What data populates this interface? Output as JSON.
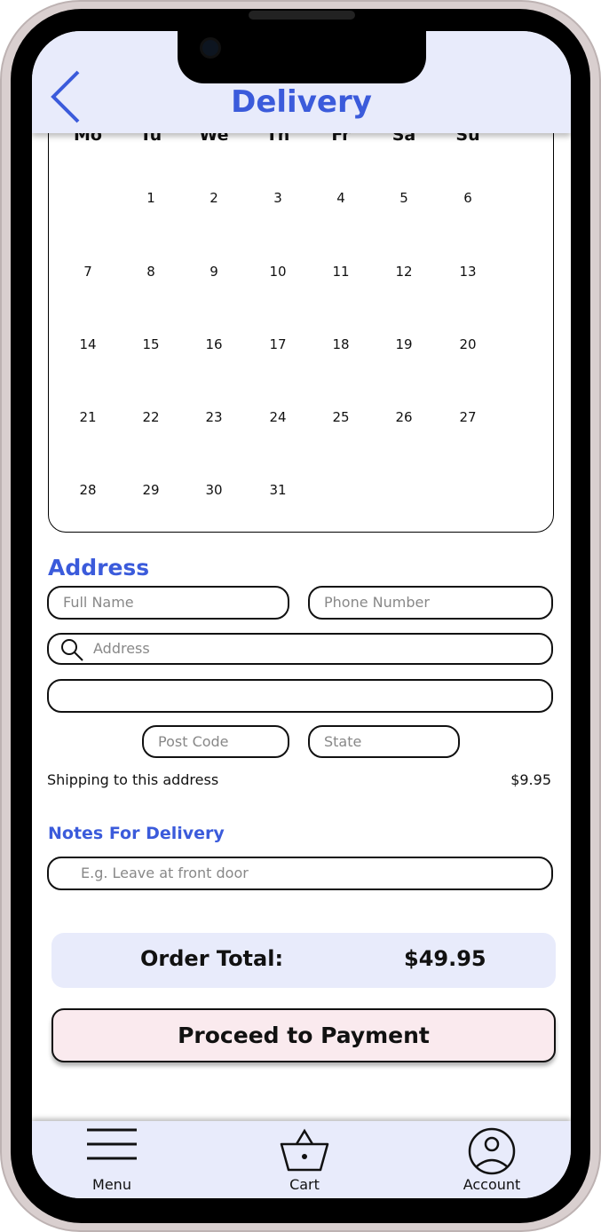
{
  "header": {
    "title": "Delivery",
    "back_icon": "chevron-left-icon"
  },
  "calendar": {
    "weekdays": [
      "Mo",
      "Tu",
      "We",
      "Th",
      "Fr",
      "Sa",
      "Su"
    ],
    "weeks": [
      [
        "",
        "1",
        "2",
        "3",
        "4",
        "5",
        "6"
      ],
      [
        "7",
        "8",
        "9",
        "10",
        "11",
        "12",
        "13"
      ],
      [
        "14",
        "15",
        "16",
        "17",
        "18",
        "19",
        "20"
      ],
      [
        "21",
        "22",
        "23",
        "24",
        "25",
        "26",
        "27"
      ],
      [
        "28",
        "29",
        "30",
        "31",
        "",
        "",
        ""
      ]
    ]
  },
  "address": {
    "heading": "Address",
    "full_name_placeholder": "Full Name",
    "phone_placeholder": "Phone Number",
    "address_placeholder": "Address",
    "address2_placeholder": "",
    "postcode_placeholder": "Post Code",
    "state_placeholder": "State"
  },
  "shipping": {
    "label": "Shipping to this address",
    "price": "$9.95"
  },
  "notes": {
    "heading": "Notes For Delivery",
    "placeholder": "E.g. Leave at front door"
  },
  "order": {
    "label": "Order Total:",
    "value": "$49.95"
  },
  "pay_button": "Proceed to Payment",
  "nav": [
    {
      "label": "Menu",
      "icon": "menu-icon"
    },
    {
      "label": "Cart",
      "icon": "basket-icon"
    },
    {
      "label": "Account",
      "icon": "account-icon"
    }
  ],
  "colors": {
    "accent": "#3b5bdb",
    "header_bg": "#e8ebfb",
    "button_bg": "#faeaee"
  }
}
